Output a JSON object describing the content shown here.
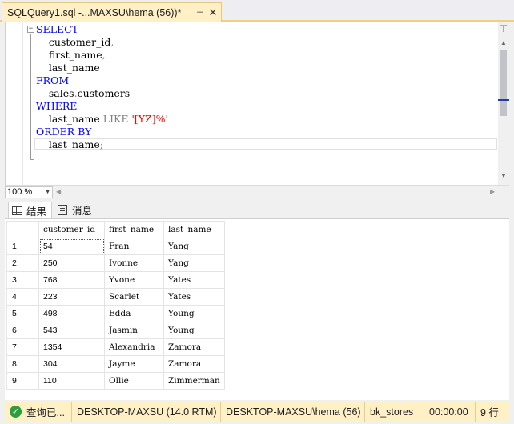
{
  "tab": {
    "title": "SQLQuery1.sql -...MAXSU\\hema (56))*",
    "pin": "⊣",
    "close": "✕"
  },
  "editor": {
    "fold_symbol": "−",
    "lines": [
      {
        "parts": [
          {
            "t": "SELECT",
            "c": "kw"
          }
        ]
      },
      {
        "parts": [
          {
            "t": "    customer_id",
            "c": ""
          },
          {
            "t": ",",
            "c": "gray"
          }
        ]
      },
      {
        "parts": [
          {
            "t": "    first_name",
            "c": ""
          },
          {
            "t": ",",
            "c": "gray"
          }
        ]
      },
      {
        "parts": [
          {
            "t": "    last_name",
            "c": ""
          }
        ]
      },
      {
        "parts": [
          {
            "t": "FROM",
            "c": "kw"
          }
        ]
      },
      {
        "parts": [
          {
            "t": "    sales",
            "c": ""
          },
          {
            "t": ".",
            "c": "gray"
          },
          {
            "t": "customers",
            "c": ""
          }
        ]
      },
      {
        "parts": [
          {
            "t": "WHERE",
            "c": "kw"
          }
        ]
      },
      {
        "parts": [
          {
            "t": "    last_name ",
            "c": ""
          },
          {
            "t": "LIKE",
            "c": "gray"
          },
          {
            "t": " ",
            "c": ""
          },
          {
            "t": "'[YZ]%'",
            "c": "str"
          }
        ]
      },
      {
        "parts": [
          {
            "t": "ORDER BY",
            "c": "kw"
          }
        ]
      },
      {
        "parts": [
          {
            "t": "    last_name",
            "c": ""
          },
          {
            "t": ";",
            "c": "gray"
          }
        ]
      }
    ]
  },
  "zoom": {
    "value": "100 %",
    "arrow": "▼"
  },
  "result_tabs": [
    {
      "label": "结果",
      "icon": "grid-icon"
    },
    {
      "label": "消息",
      "icon": "message-icon"
    }
  ],
  "results": {
    "columns": [
      "customer_id",
      "first_name",
      "last_name"
    ],
    "rows": [
      [
        "1",
        "54",
        "Fran",
        "Yang"
      ],
      [
        "2",
        "250",
        "Ivonne",
        "Yang"
      ],
      [
        "3",
        "768",
        "Yvone",
        "Yates"
      ],
      [
        "4",
        "223",
        "Scarlet",
        "Yates"
      ],
      [
        "5",
        "498",
        "Edda",
        "Young"
      ],
      [
        "6",
        "543",
        "Jasmin",
        "Young"
      ],
      [
        "7",
        "1354",
        "Alexandria",
        "Zamora"
      ],
      [
        "8",
        "304",
        "Jayme",
        "Zamora"
      ],
      [
        "9",
        "110",
        "Ollie",
        "Zimmerman"
      ]
    ]
  },
  "status": {
    "query_state": "查询已...",
    "server": "DESKTOP-MAXSU (14.0 RTM)",
    "user": "DESKTOP-MAXSU\\hema (56)",
    "database": "bk_stores",
    "elapsed": "00:00:00",
    "rows": "9 行",
    "ok_glyph": "✓"
  },
  "colors": {
    "accent_bar": "#fff0c6",
    "keyword": "#0000ff",
    "string": "#ff0000",
    "ok": "#2e9d3e"
  }
}
